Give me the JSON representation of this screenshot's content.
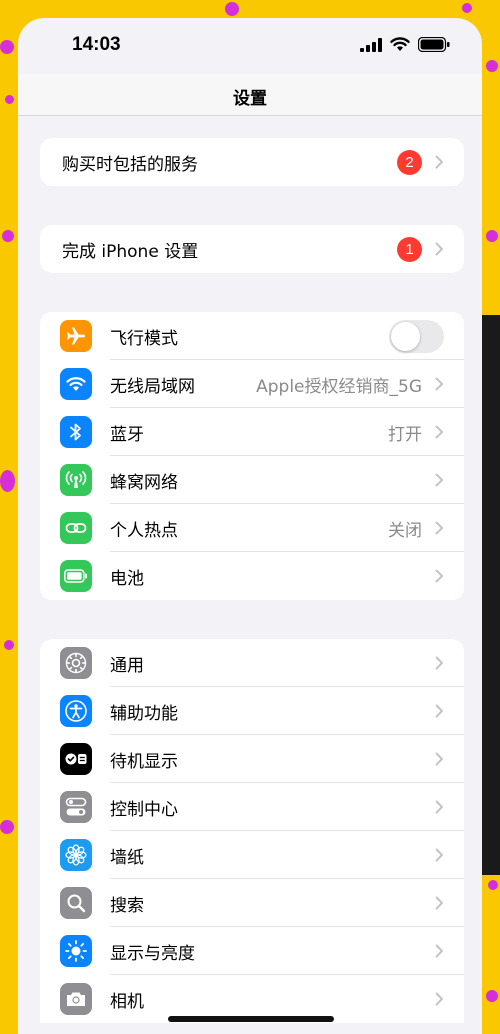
{
  "status_bar": {
    "time": "14:03",
    "icons": [
      "cellular-signal-icon",
      "wifi-icon",
      "battery-icon"
    ]
  },
  "nav": {
    "title": "设置"
  },
  "group1": {
    "label": "购买时包括的服务",
    "badge": "2"
  },
  "group2": {
    "label": "完成 iPhone 设置",
    "badge": "1"
  },
  "connectivity": {
    "items": [
      {
        "label": "飞行模式",
        "icon": "airplane-icon",
        "color": "#ff9500",
        "toggle": false
      },
      {
        "label": "无线局域网",
        "value": "Apple授权经销商_5G",
        "icon": "wifi-icon",
        "color": "#0a84ff"
      },
      {
        "label": "蓝牙",
        "value": "打开",
        "icon": "bluetooth-icon",
        "color": "#0a84ff"
      },
      {
        "label": "蜂窝网络",
        "icon": "cellular-antenna-icon",
        "color": "#34c759"
      },
      {
        "label": "个人热点",
        "value": "关闭",
        "icon": "hotspot-link-icon",
        "color": "#34c759"
      },
      {
        "label": "电池",
        "icon": "battery-icon",
        "color": "#34c759"
      }
    ]
  },
  "general": {
    "items": [
      {
        "label": "通用",
        "icon": "gear-icon",
        "color": "#8e8e93"
      },
      {
        "label": "辅助功能",
        "icon": "accessibility-icon",
        "color": "#0a84ff"
      },
      {
        "label": "待机显示",
        "icon": "standby-icon",
        "color": "#000000"
      },
      {
        "label": "控制中心",
        "icon": "control-center-icon",
        "color": "#8e8e93"
      },
      {
        "label": "墙纸",
        "icon": "wallpaper-flower-icon",
        "color": "#1c9bf0"
      },
      {
        "label": "搜索",
        "icon": "search-icon",
        "color": "#8e8e93"
      },
      {
        "label": "显示与亮度",
        "icon": "brightness-sun-icon",
        "color": "#0a84ff"
      },
      {
        "label": "相机",
        "icon": "camera-icon",
        "color": "#8e8e93"
      }
    ]
  }
}
